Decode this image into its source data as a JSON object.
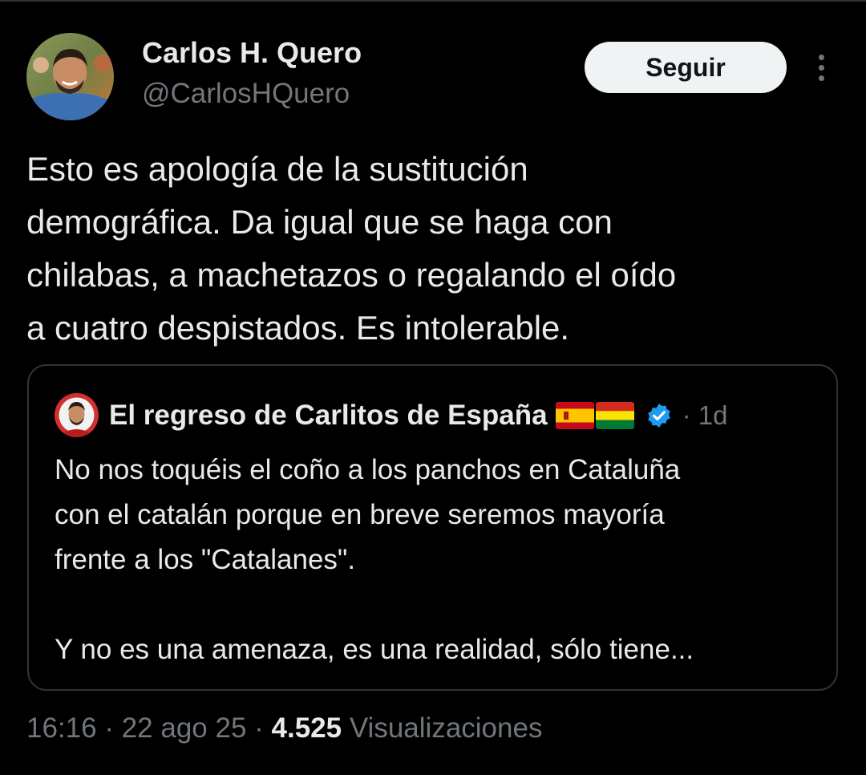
{
  "author": {
    "name": "Carlos H. Quero",
    "handle": "@CarlosHQuero"
  },
  "follow_label": "Seguir",
  "more_icon": "more-horizontal-icon",
  "tweet_text": "Esto es apología de la sustitución\ndemográfica. Da igual que se haga con\nchilabas, a machetazos o regalando el oído\na cuatro despistados. Es intolerable.",
  "quoted": {
    "name": "El regreso de Carlitos de España",
    "flags": [
      "flag-spain-icon",
      "flag-bolivia-icon"
    ],
    "verified_icon": "verified-badge-icon",
    "time": "· 1d",
    "text": "No nos toquéis el coño a los panchos en Cataluña\ncon el catalán porque en breve seremos mayoría\nfrente a los \"Catalanes\".\n\nY no es una amenaza, es una realidad, sólo tiene..."
  },
  "meta": {
    "time": "16:16",
    "sep1": " · ",
    "date": "22 ago 25",
    "sep2": " · ",
    "views_count": "4.525",
    "views_label": " Visualizaciones"
  },
  "colors": {
    "background": "#000000",
    "text": "#e7e9ea",
    "secondary": "#71767b",
    "border": "#2f3336",
    "follow_bg": "#eff3f4",
    "verified": "#1d9bf0"
  }
}
